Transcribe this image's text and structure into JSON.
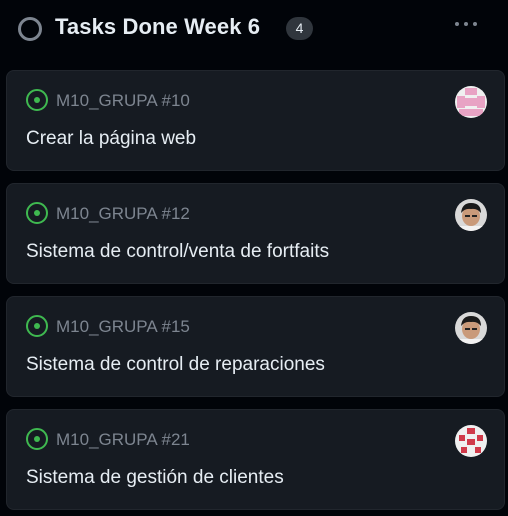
{
  "column": {
    "title": "Tasks Done Week 6",
    "count": "4",
    "menu_icon": "kebab-horizontal-icon",
    "status_icon": "circle-outline-icon"
  },
  "cards": [
    {
      "ref": "M10_GRUPA #10",
      "title": "Crear la página web",
      "avatar": "identicon-pink"
    },
    {
      "ref": "M10_GRUPA #12",
      "title": "Sistema de control/venta de fortfaits",
      "avatar": "user-photo"
    },
    {
      "ref": "M10_GRUPA #15",
      "title": "Sistema de control de reparaciones",
      "avatar": "user-photo"
    },
    {
      "ref": "M10_GRUPA #21",
      "title": "Sistema de gestión de clientes",
      "avatar": "identicon-red"
    }
  ],
  "colors": {
    "background": "#010409",
    "card": "#161b22",
    "open_issue": "#3fb950",
    "muted_text": "#7d8590"
  }
}
